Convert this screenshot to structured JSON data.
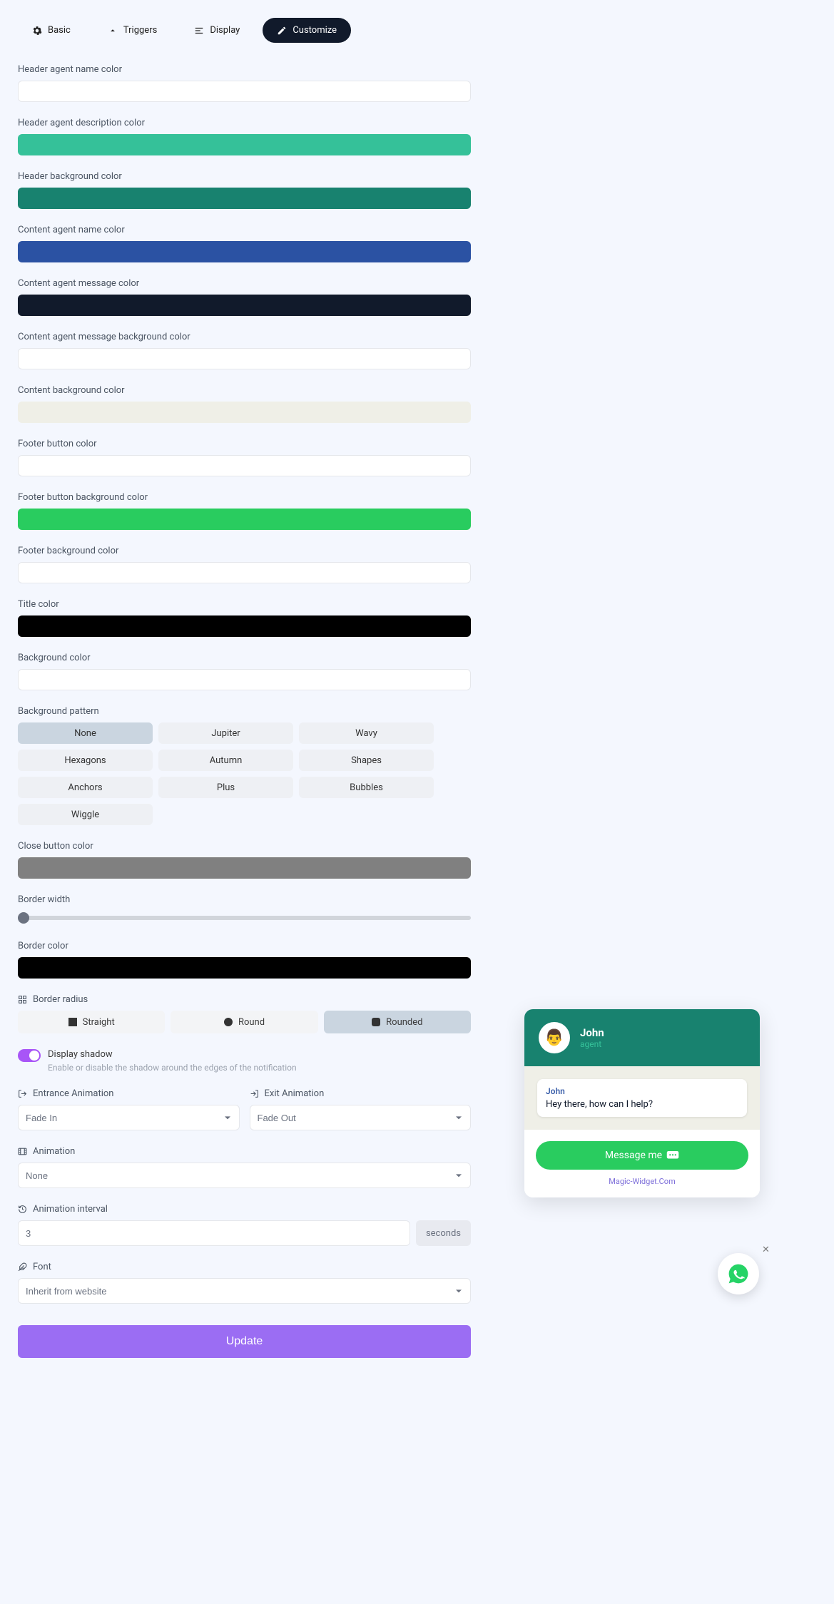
{
  "tabs": {
    "basic": "Basic",
    "triggers": "Triggers",
    "display": "Display",
    "customize": "Customize"
  },
  "fields": {
    "header_agent_name": {
      "label": "Header agent name color",
      "color": "#ffffff"
    },
    "header_agent_desc": {
      "label": "Header agent description color",
      "color": "#35c199"
    },
    "header_bg": {
      "label": "Header background color",
      "color": "#18826f"
    },
    "content_agent_name": {
      "label": "Content agent name color",
      "color": "#2b52a3"
    },
    "content_agent_msg": {
      "label": "Content agent message color",
      "color": "#111a2b"
    },
    "content_agent_msg_bg": {
      "label": "Content agent message background color",
      "color": "#ffffff"
    },
    "content_bg": {
      "label": "Content background color",
      "color": "#efefe7"
    },
    "footer_btn": {
      "label": "Footer button color",
      "color": "#ffffff"
    },
    "footer_btn_bg": {
      "label": "Footer button background color",
      "color": "#29cc5f"
    },
    "footer_bg": {
      "label": "Footer background color",
      "color": "#ffffff"
    },
    "title_color": {
      "label": "Title color",
      "color": "#000000"
    },
    "bg_color": {
      "label": "Background color",
      "color": "#ffffff"
    },
    "close_btn": {
      "label": "Close button color",
      "color": "#808080"
    },
    "border_color": {
      "label": "Border color",
      "color": "#000000"
    }
  },
  "pattern": {
    "label": "Background pattern",
    "opts": [
      "None",
      "Jupiter",
      "Wavy",
      "Hexagons",
      "Autumn",
      "Shapes",
      "Anchors",
      "Plus",
      "Bubbles",
      "Wiggle"
    ],
    "selected": "None"
  },
  "border_width": {
    "label": "Border width",
    "value": 0
  },
  "border_radius": {
    "label": "Border radius",
    "opts": [
      "Straight",
      "Round",
      "Rounded"
    ],
    "selected": "Rounded"
  },
  "shadow": {
    "label": "Display shadow",
    "desc": "Enable or disable the shadow around the edges of the notification",
    "value": true
  },
  "entrance": {
    "label": "Entrance Animation",
    "value": "Fade In"
  },
  "exit": {
    "label": "Exit Animation",
    "value": "Fade Out"
  },
  "animation": {
    "label": "Animation",
    "value": "None"
  },
  "interval": {
    "label": "Animation interval",
    "value": "3",
    "unit": "seconds"
  },
  "font": {
    "label": "Font",
    "value": "Inherit from website"
  },
  "update": "Update",
  "preview": {
    "agent_name": "John",
    "agent_role": "agent",
    "msg_from": "John",
    "msg_text": "Hey there, how can I help?",
    "btn": "Message me",
    "brand": "Magic-Widget.Com"
  }
}
